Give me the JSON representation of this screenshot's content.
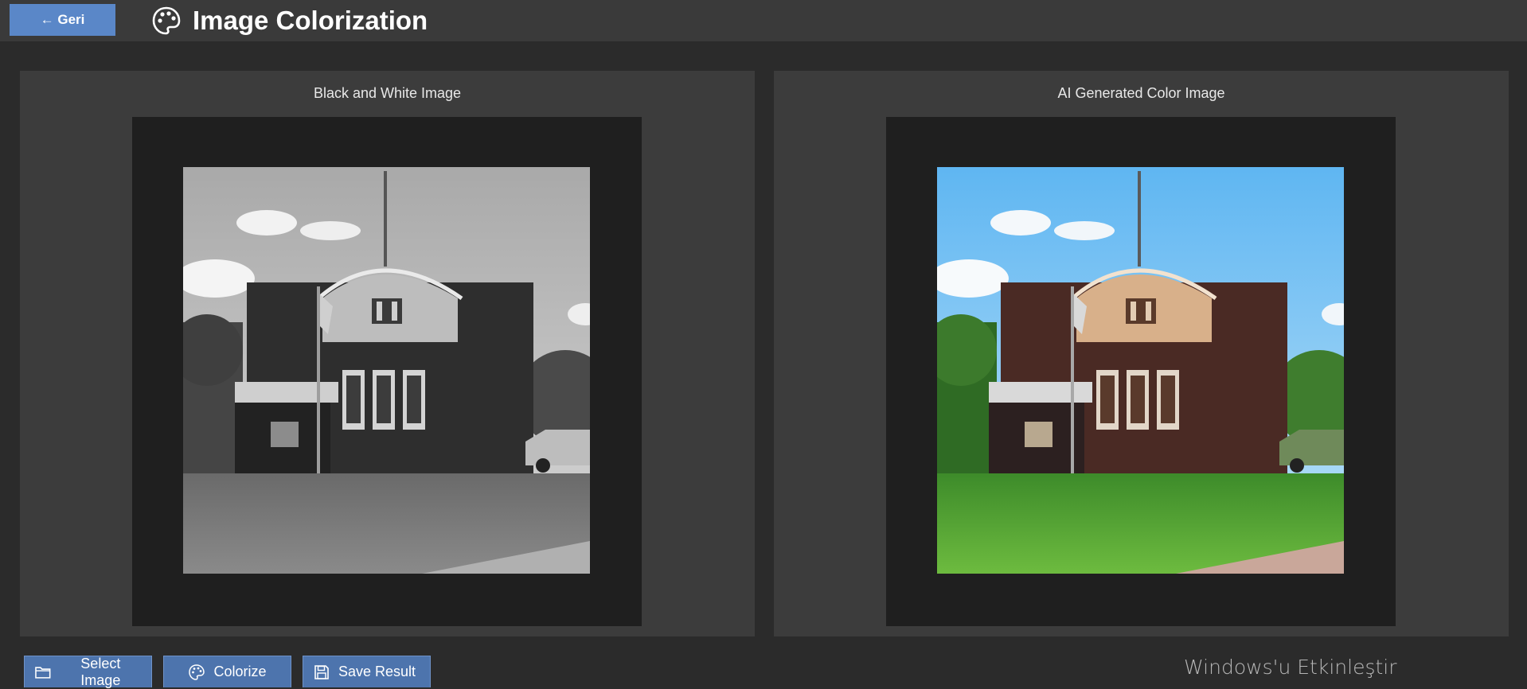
{
  "header": {
    "back_label": "← Geri",
    "title": "Image Colorization",
    "title_icon": "palette-icon"
  },
  "panels": {
    "left": {
      "label": "Black and White Image"
    },
    "right": {
      "label": "AI Generated Color Image"
    }
  },
  "actions": {
    "select_label": "Select Image",
    "select_icon": "folder-icon",
    "colorize_label": "Colorize",
    "colorize_icon": "palette-icon",
    "save_label": "Save Result",
    "save_icon": "floppy-disk-icon"
  },
  "watermark": {
    "text": "Windows'u Etkinleştir"
  },
  "colors": {
    "background": "#2b2b2b",
    "header": "#3a3a3a",
    "panel": "#3c3c3c",
    "frame": "#1f1f1f",
    "back_button": "#5a87c8",
    "action_button": "#4d74ad"
  }
}
